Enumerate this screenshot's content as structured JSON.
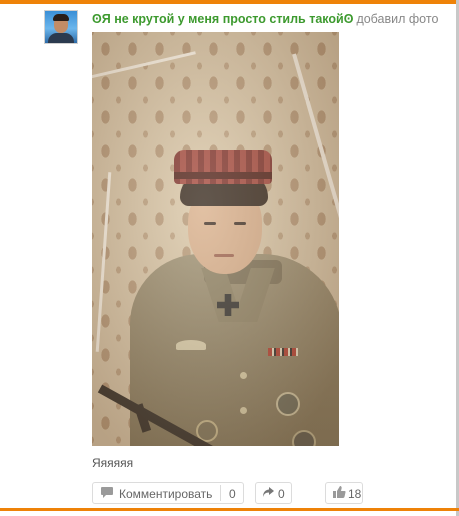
{
  "colors": {
    "accent_bar": "#ee8208",
    "author_name": "#3d9a2f",
    "muted_text": "#888888"
  },
  "post": {
    "author_icon": "ʘ",
    "author_name": "Я не крутой у меня просто стиль такойʘ",
    "action": "добавил фото",
    "caption": "Яяяяяя"
  },
  "actions": {
    "comment_icon": "speech-bubble-icon",
    "comment_label": "Комментировать",
    "comment_count": "0",
    "share_icon": "share-arrow-icon",
    "share_count": "0",
    "like_icon": "thumbs-up-icon",
    "like_count": "18"
  }
}
